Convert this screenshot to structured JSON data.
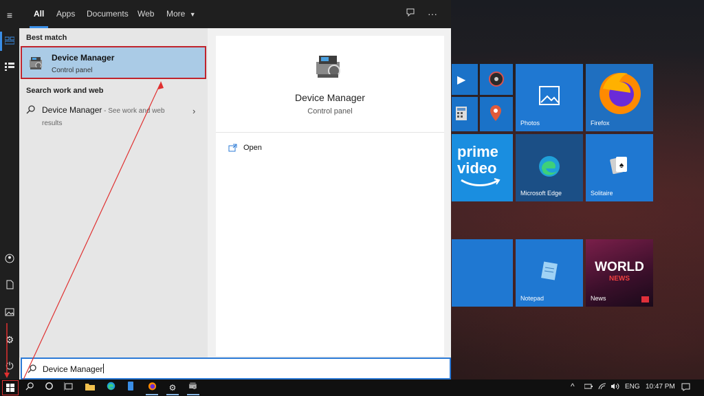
{
  "tabs": {
    "all": "All",
    "apps": "Apps",
    "documents": "Documents",
    "web": "Web",
    "more": "More"
  },
  "sections": {
    "best_match": "Best match",
    "search_web": "Search work and web"
  },
  "best_match": {
    "title": "Device Manager",
    "subtitle": "Control panel"
  },
  "web_result": {
    "title": "Device Manager",
    "suffix": " - See work and web results"
  },
  "preview": {
    "title": "Device Manager",
    "subtitle": "Control panel",
    "action": "Open"
  },
  "search": {
    "query": "Device Manager"
  },
  "tiles": {
    "photos": "Photos",
    "firefox": "Firefox",
    "edge": "Microsoft Edge",
    "solitaire": "Solitaire",
    "notepad": "Notepad",
    "news": "News",
    "prime_line1": "prime",
    "prime_line2": "video",
    "news_world": "WORLD",
    "news_news": "NEWS"
  },
  "tray": {
    "lang": "ENG",
    "time": "10:47 PM"
  },
  "colors": {
    "accent": "#3a8ee6",
    "highlight": "#aacbe6",
    "annotation": "#c0232c"
  }
}
